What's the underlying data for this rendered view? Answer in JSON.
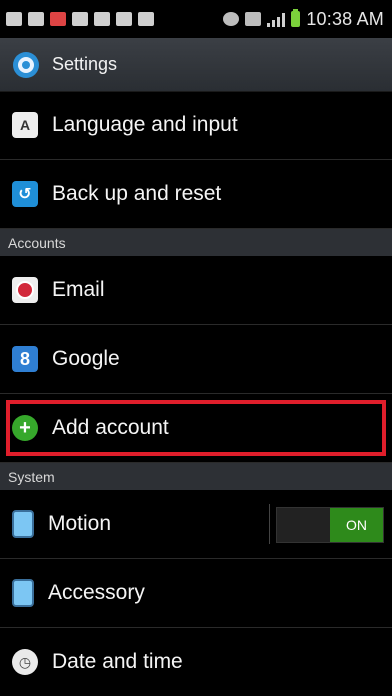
{
  "statusbar": {
    "time": "10:38 AM"
  },
  "header": {
    "title": "Settings"
  },
  "rows": [
    {
      "label": "Language and input",
      "icon": "language-icon"
    },
    {
      "label": "Back up and reset",
      "icon": "backup-icon"
    }
  ],
  "sections": {
    "accounts": "Accounts",
    "system": "System"
  },
  "accounts": {
    "email": "Email",
    "google": "Google",
    "add": "Add account"
  },
  "system": {
    "motion": "Motion",
    "motion_toggle": "ON",
    "accessory": "Accessory",
    "datetime": "Date and time"
  },
  "colors": {
    "highlight": "#e01e2b",
    "toggle_on": "#2e8a1b"
  }
}
